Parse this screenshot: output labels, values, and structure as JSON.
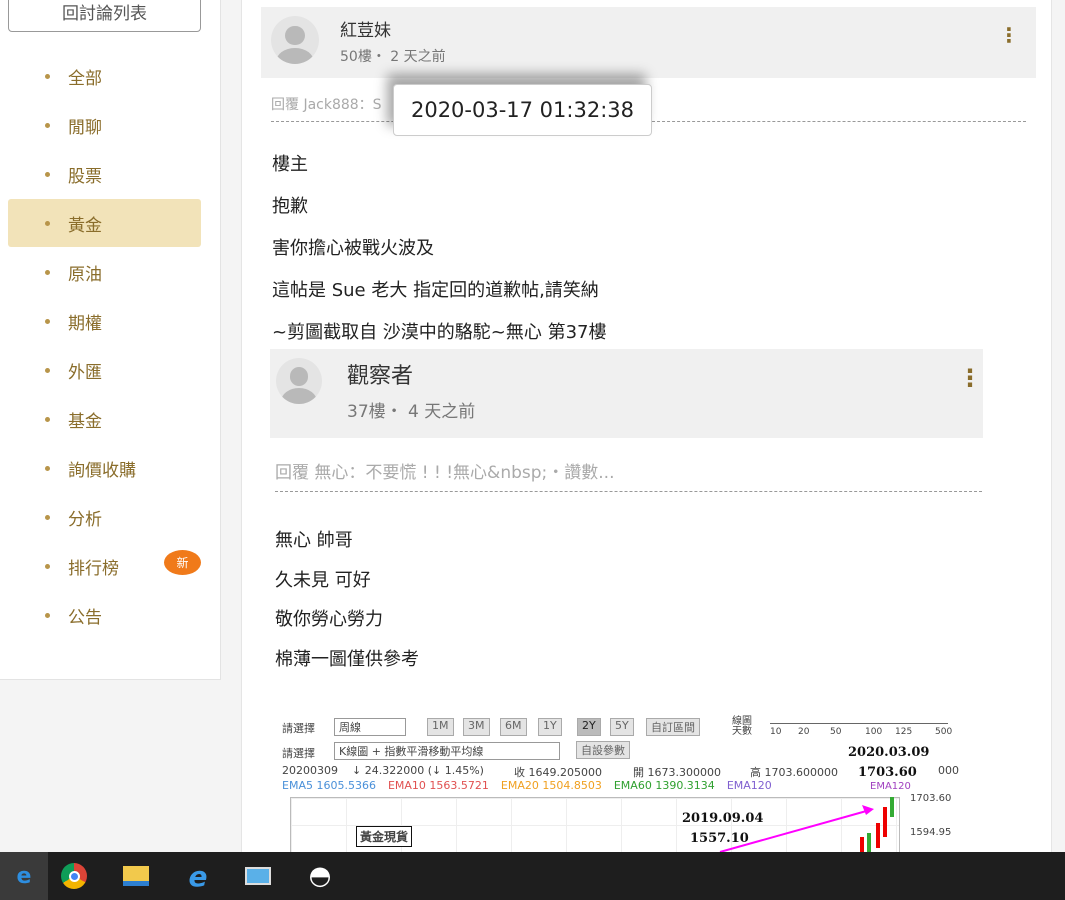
{
  "sidebar": {
    "back_label": "回討論列表",
    "items": [
      "全部",
      "閒聊",
      "股票",
      "黃金",
      "原油",
      "期權",
      "外匯",
      "基金",
      "詢價收購",
      "分析",
      "排行榜",
      "公告"
    ],
    "active": "黃金",
    "new_badge": "新"
  },
  "post": {
    "user": "紅荳妹",
    "meta": "50樓・ 2 天之前",
    "reply": "回覆 Jack888：S",
    "tooltip": "2020-03-17 01:32:38",
    "lines": [
      "樓主",
      "抱歉",
      "害你擔心被戰火波及",
      "這帖是 Sue 老大 指定回的道歉帖,請笑納",
      "~剪圖截取自 沙漠中的駱駝~無心 第37樓"
    ]
  },
  "quoted": {
    "user": "觀察者",
    "meta": "37樓・ 4 天之前",
    "reply": "回覆 無心：不要慌 ! ! !無心&nbsp;・讚數...",
    "lines": [
      "無心  帥哥",
      "久未見  可好",
      "敬你勞心勞力",
      "棉薄一圖僅供參考"
    ]
  },
  "chart": {
    "select_label": "請選擇",
    "period": "周線",
    "ranges": [
      "1M",
      "3M",
      "6M",
      "1Y",
      "2Y",
      "5Y",
      "自訂區間"
    ],
    "days_label": "線圖天數",
    "days": [
      "10",
      "20",
      "50",
      "100",
      "125",
      "500"
    ],
    "select2": "K線圖 + 指數平滑移動平均線",
    "custom": "自設參數",
    "date": "20200309",
    "change": "↓ 24.322000 (↓ 1.45%)",
    "close": "收 1649.205000",
    "open": "開 1673.300000",
    "high": "高 1703.600000",
    "extra": "000",
    "ema": [
      {
        "t": "EMA5 1605.5366",
        "c": "#4a90d9"
      },
      {
        "t": "EMA10 1563.5721",
        "c": "#e05050"
      },
      {
        "t": "EMA20 1504.8503",
        "c": "#f0a020"
      },
      {
        "t": "EMA60 1390.3134",
        "c": "#30a030"
      },
      {
        "t": "EMA120",
        "c": "#8060d0"
      }
    ],
    "ann1_date": "2020.03.09",
    "ann1_val": "1703.60",
    "ann2_date": "2019.09.04",
    "ann2_val": "1557.10",
    "label": "黃金現貨",
    "y1": "1703.60",
    "y2": "1594.95",
    "ema120_tag": "EMA120"
  }
}
